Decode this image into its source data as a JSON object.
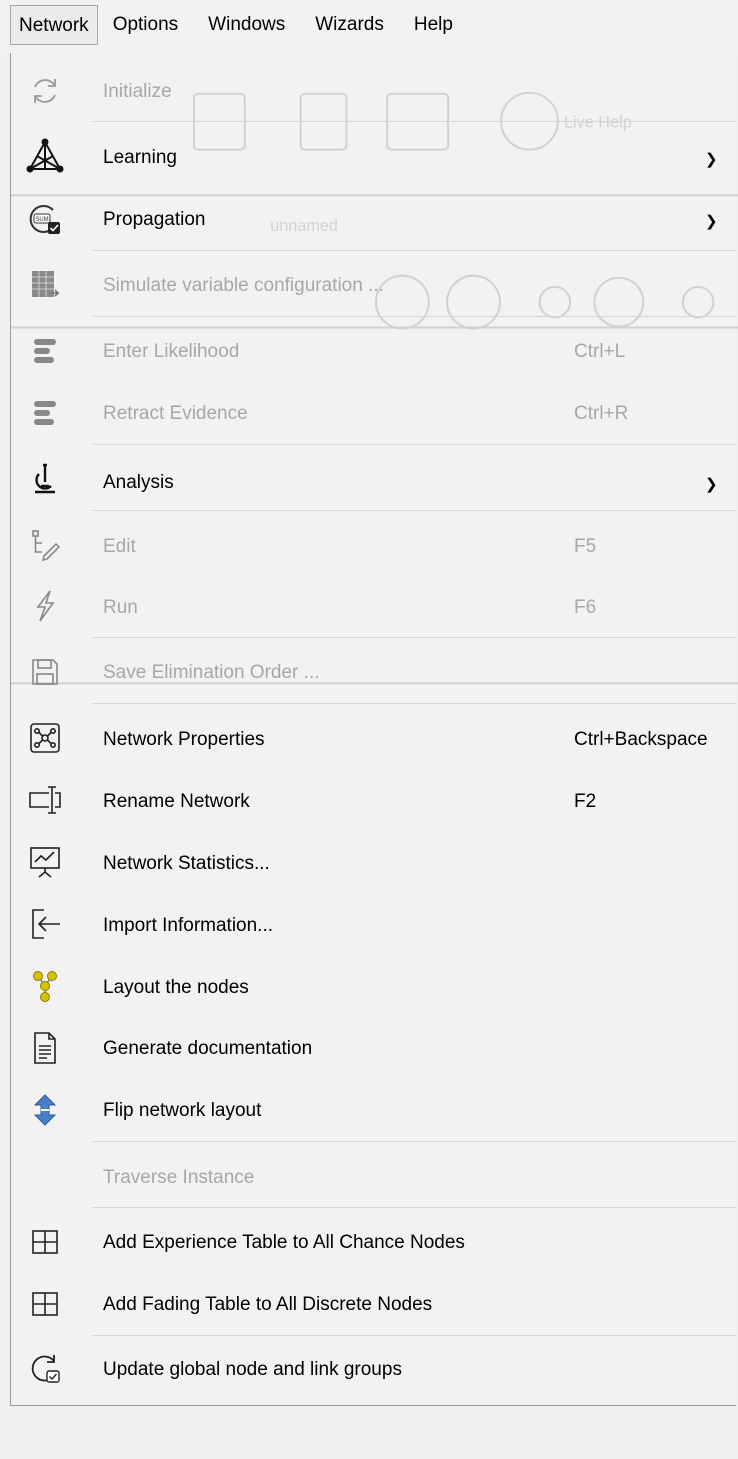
{
  "menubar": {
    "items": [
      "Network",
      "Options",
      "Windows",
      "Wizards",
      "Help"
    ]
  },
  "background": {
    "live_help": "Live Help",
    "document_tab": "unnamed"
  },
  "menu": {
    "items": [
      {
        "label": "Initialize",
        "icon": "refresh-icon",
        "enabled": false
      },
      {
        "label": "Learning",
        "icon": "triangle-network-icon",
        "enabled": true,
        "submenu": true
      },
      {
        "label": "Propagation",
        "icon": "sum-propagation-icon",
        "enabled": true,
        "submenu": true
      },
      {
        "label": "Simulate variable configuration ...",
        "icon": "simulate-table-icon",
        "enabled": false
      },
      {
        "label": "Enter Likelihood",
        "shortcut": "Ctrl+L",
        "icon": "likelihood-bars-icon",
        "enabled": false
      },
      {
        "label": "Retract Evidence",
        "shortcut": "Ctrl+R",
        "icon": "evidence-bars-icon",
        "enabled": false
      },
      {
        "label": "Analysis",
        "icon": "microscope-icon",
        "enabled": true,
        "submenu": true
      },
      {
        "label": "Edit",
        "shortcut": "F5",
        "icon": "edit-tree-icon",
        "enabled": false
      },
      {
        "label": "Run",
        "shortcut": "F6",
        "icon": "lightning-icon",
        "enabled": false
      },
      {
        "label": "Save Elimination Order ...",
        "icon": "floppy-icon",
        "enabled": false
      },
      {
        "label": "Network Properties",
        "shortcut": "Ctrl+Backspace",
        "icon": "network-properties-icon",
        "enabled": true
      },
      {
        "label": "Rename Network",
        "shortcut": "F2",
        "icon": "rename-icon",
        "enabled": true
      },
      {
        "label": "Network Statistics...",
        "icon": "statistics-chart-icon",
        "enabled": true
      },
      {
        "label": "Import Information...",
        "icon": "import-icon",
        "enabled": true
      },
      {
        "label": "Layout the nodes",
        "icon": "layout-nodes-icon",
        "enabled": true
      },
      {
        "label": "Generate documentation",
        "icon": "document-icon",
        "enabled": true
      },
      {
        "label": "Flip network layout",
        "icon": "flip-arrows-icon",
        "enabled": true
      },
      {
        "label": "Traverse Instance",
        "enabled": false
      },
      {
        "label": "Add Experience Table to All Chance Nodes",
        "icon": "table-grid-icon",
        "enabled": true
      },
      {
        "label": "Add Fading Table to All Discrete Nodes",
        "icon": "table-grid-icon",
        "enabled": true
      },
      {
        "label": "Update global node and link groups",
        "icon": "update-groups-icon",
        "enabled": true
      }
    ]
  },
  "colors": {
    "disabled_text": "#a7a7a7",
    "menu_bg": "#f2f2f2",
    "separator": "#d6d6d6",
    "flip_icon": "#4a7fc8",
    "layout_icon": "#c8b400"
  }
}
